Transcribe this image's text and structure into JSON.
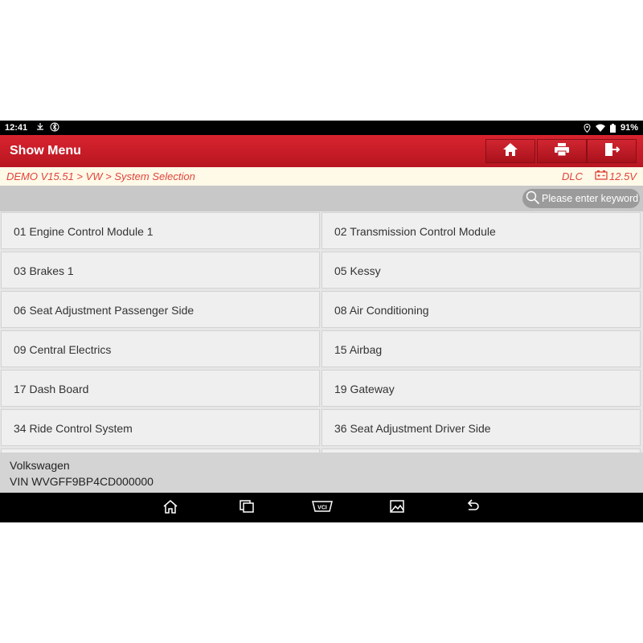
{
  "status_bar": {
    "time": "12:41",
    "battery": "91%"
  },
  "header": {
    "title": "Show Menu"
  },
  "breadcrumb": {
    "path": "DEMO V15.51 > VW > System Selection",
    "dlc": "DLC",
    "voltage": "12.5V"
  },
  "search": {
    "placeholder": "Please enter keyword",
    "value": ""
  },
  "systems": [
    "01 Engine Control Module 1",
    "02 Transmission Control Module",
    "03 Brakes 1",
    "05 Kessy",
    "06 Seat Adjustment Passenger Side",
    "08 Air Conditioning",
    "09 Central Electrics",
    "15 Airbag",
    "17 Dash Board",
    "19 Gateway",
    "34 Ride Control System",
    "36 Seat Adjustment Driver Side"
  ],
  "vehicle": {
    "make": "Volkswagen",
    "vin": "VIN WVGFF9BP4CD000000"
  },
  "nav_bar": {
    "vci_label": "VCI"
  },
  "colors": {
    "accent": "#c81b26",
    "breadcrumb_text": "#e0443a",
    "statusbar": "#000000"
  }
}
